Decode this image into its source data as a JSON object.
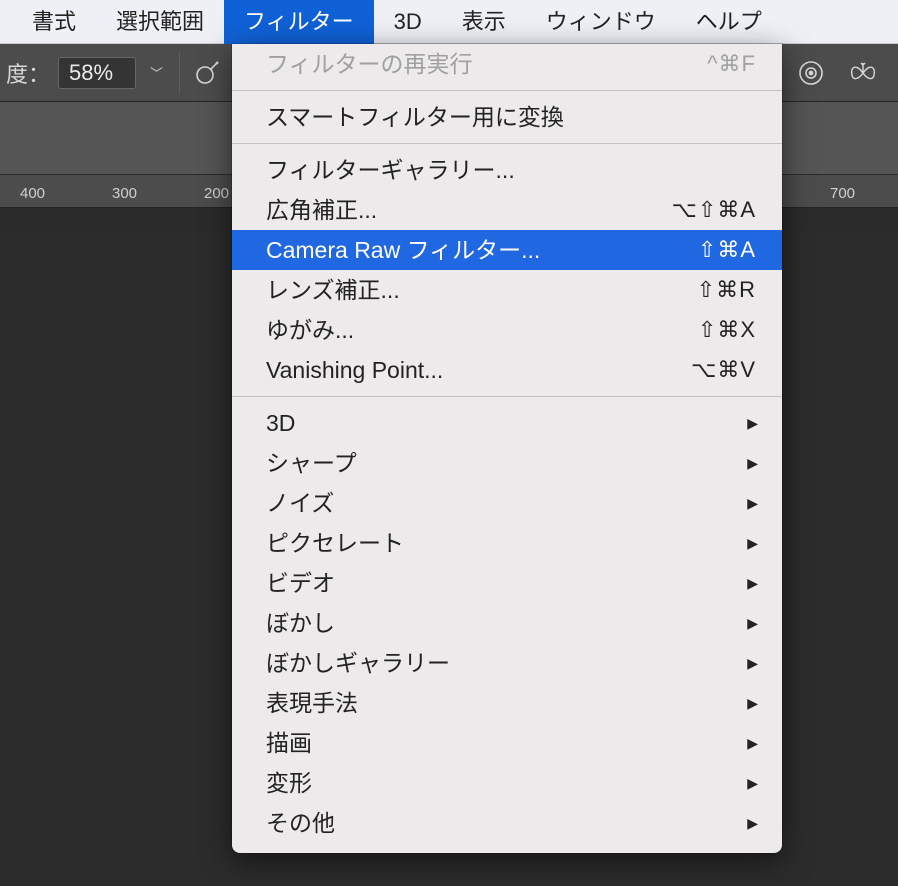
{
  "menubar": {
    "shoshiki": "書式",
    "sentakuhanni": "選択範囲",
    "filter": "フィルター",
    "threeD": "3D",
    "hyoji": "表示",
    "window": "ウィンドウ",
    "help": "ヘルプ"
  },
  "opts": {
    "label_prefix": "度：",
    "pct_value": "58%"
  },
  "ruler": {
    "t400": "400",
    "t300": "300",
    "t200": "200",
    "t700": "700"
  },
  "dropdown": {
    "re_filter_label": "フィルターの再実行",
    "re_filter_sc": "^⌘F",
    "smart_convert": "スマートフィルター用に変換",
    "filter_gallery": "フィルターギャラリー...",
    "wide_angle": "広角補正...",
    "wide_angle_sc": "⌥⇧⌘A",
    "camera_raw": "Camera Raw フィルター...",
    "camera_raw_sc": "⇧⌘A",
    "lens_corr": "レンズ補正...",
    "lens_corr_sc": "⇧⌘R",
    "liquify": "ゆがみ...",
    "liquify_sc": "⇧⌘X",
    "vanishing": "Vanishing Point...",
    "vanishing_sc": "⌥⌘V",
    "sub_3d": "3D",
    "sub_sharp": "シャープ",
    "sub_noise": "ノイズ",
    "sub_pixelate": "ピクセレート",
    "sub_video": "ビデオ",
    "sub_blur": "ぼかし",
    "sub_blur_gallery": "ぼかしギャラリー",
    "sub_stylize": "表現手法",
    "sub_render": "描画",
    "sub_distort": "変形",
    "sub_other": "その他"
  }
}
